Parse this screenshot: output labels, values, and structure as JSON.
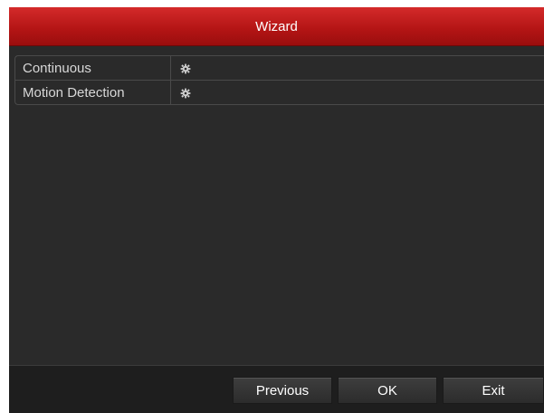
{
  "window": {
    "title": "Wizard"
  },
  "rows": [
    {
      "label": "Continuous",
      "icon": "gear-icon"
    },
    {
      "label": "Motion Detection",
      "icon": "gear-icon"
    }
  ],
  "footer": {
    "previous_label": "Previous",
    "ok_label": "OK",
    "exit_label": "Exit"
  },
  "colors": {
    "title_bar": "#b21414",
    "background": "#2a2a2a",
    "text": "#d8d8d8"
  }
}
